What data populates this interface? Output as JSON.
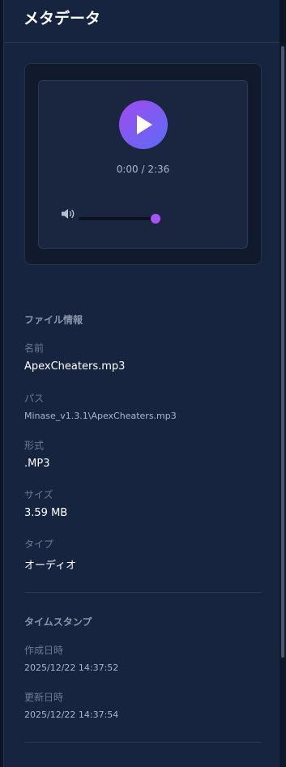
{
  "header": {
    "title": "メタデータ"
  },
  "player": {
    "time": "0:00 / 2:36",
    "volume_level": 1.0,
    "accent_color": "#a855f7"
  },
  "file_info": {
    "section_title": "ファイル情報",
    "name_label": "名前",
    "name_value": "ApexCheaters.mp3",
    "path_label": "パス",
    "path_value": "Minase_v1.3.1\\ApexCheaters.mp3",
    "format_label": "形式",
    "format_value": ".MP3",
    "size_label": "サイズ",
    "size_value": "3.59 MB",
    "type_label": "タイプ",
    "type_value": "オーディオ"
  },
  "timestamps": {
    "section_title": "タイムスタンプ",
    "created_label": "作成日時",
    "created_value": "2025/12/22 14:37:52",
    "modified_label": "更新日時",
    "modified_value": "2025/12/22 14:37:54"
  }
}
